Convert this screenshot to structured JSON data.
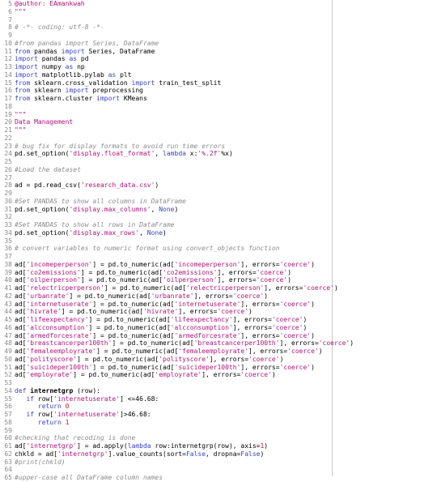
{
  "lines": [
    {
      "n": "5",
      "t": [
        {
          "c": "c-str",
          "s": "@author: EAmankwah"
        }
      ]
    },
    {
      "n": "6",
      "t": [
        {
          "c": "c-str",
          "s": "\"\"\""
        }
      ]
    },
    {
      "n": "7",
      "t": []
    },
    {
      "n": "8",
      "t": [
        {
          "c": "c-com",
          "s": "# -*- coding: utf-8 -*-"
        }
      ]
    },
    {
      "n": "9",
      "t": []
    },
    {
      "n": "10",
      "t": [
        {
          "c": "c-com",
          "s": "#from pandas import Series, DataFrame"
        }
      ]
    },
    {
      "n": "11",
      "t": [
        {
          "c": "c-kw",
          "s": "from"
        },
        {
          "c": "c-plain",
          "s": " pandas "
        },
        {
          "c": "c-kw",
          "s": "import"
        },
        {
          "c": "c-plain",
          "s": " Series, DataFrame"
        }
      ]
    },
    {
      "n": "12",
      "t": [
        {
          "c": "c-kw",
          "s": "import"
        },
        {
          "c": "c-plain",
          "s": " pandas "
        },
        {
          "c": "c-kw",
          "s": "as"
        },
        {
          "c": "c-plain",
          "s": " pd"
        }
      ]
    },
    {
      "n": "13",
      "t": [
        {
          "c": "c-kw",
          "s": "import"
        },
        {
          "c": "c-plain",
          "s": " numpy "
        },
        {
          "c": "c-kw",
          "s": "as"
        },
        {
          "c": "c-plain",
          "s": " np"
        }
      ]
    },
    {
      "n": "14",
      "t": [
        {
          "c": "c-kw",
          "s": "import"
        },
        {
          "c": "c-plain",
          "s": " matplotlib.pylab "
        },
        {
          "c": "c-kw",
          "s": "as"
        },
        {
          "c": "c-plain",
          "s": " plt"
        }
      ]
    },
    {
      "n": "15",
      "t": [
        {
          "c": "c-kw",
          "s": "from"
        },
        {
          "c": "c-plain",
          "s": " sklearn.cross_validation "
        },
        {
          "c": "c-kw",
          "s": "import"
        },
        {
          "c": "c-plain",
          "s": " train_test_split"
        }
      ]
    },
    {
      "n": "16",
      "t": [
        {
          "c": "c-kw",
          "s": "from"
        },
        {
          "c": "c-plain",
          "s": " sklearn "
        },
        {
          "c": "c-kw",
          "s": "import"
        },
        {
          "c": "c-plain",
          "s": " preprocessing"
        }
      ]
    },
    {
      "n": "17",
      "t": [
        {
          "c": "c-kw",
          "s": "from"
        },
        {
          "c": "c-plain",
          "s": " sklearn.cluster "
        },
        {
          "c": "c-kw",
          "s": "import"
        },
        {
          "c": "c-plain",
          "s": " KMeans"
        }
      ]
    },
    {
      "n": "18",
      "t": []
    },
    {
      "n": "19",
      "t": [
        {
          "c": "c-str",
          "s": "\"\"\""
        }
      ]
    },
    {
      "n": "20",
      "t": [
        {
          "c": "c-str",
          "s": "Data Management"
        }
      ]
    },
    {
      "n": "21",
      "t": [
        {
          "c": "c-str",
          "s": "\"\"\""
        }
      ]
    },
    {
      "n": "22",
      "t": []
    },
    {
      "n": "23",
      "t": [
        {
          "c": "c-com",
          "s": "# bug fix for display formats to avoid run time errors"
        }
      ]
    },
    {
      "n": "24",
      "t": [
        {
          "c": "c-plain",
          "s": "pd.set_option("
        },
        {
          "c": "c-str",
          "s": "'display.float_format'"
        },
        {
          "c": "c-plain",
          "s": ", "
        },
        {
          "c": "c-kw",
          "s": "lambda"
        },
        {
          "c": "c-plain",
          "s": " x:"
        },
        {
          "c": "c-str",
          "s": "'%.2f'"
        },
        {
          "c": "c-plain",
          "s": "%x)"
        }
      ]
    },
    {
      "n": "25",
      "t": []
    },
    {
      "n": "26",
      "t": [
        {
          "c": "c-com",
          "s": "#Load the dataset"
        }
      ]
    },
    {
      "n": "27",
      "t": []
    },
    {
      "n": "28",
      "t": [
        {
          "c": "c-plain",
          "s": "ad = pd.read_csv("
        },
        {
          "c": "c-str",
          "s": "'research_data.csv'"
        },
        {
          "c": "c-plain",
          "s": ")"
        }
      ]
    },
    {
      "n": "29",
      "t": []
    },
    {
      "n": "30",
      "t": [
        {
          "c": "c-com",
          "s": "#Set PANDAS to show all columns in DataFrame"
        }
      ]
    },
    {
      "n": "31",
      "t": [
        {
          "c": "c-plain",
          "s": "pd.set_option("
        },
        {
          "c": "c-str",
          "s": "'display.max_columns'"
        },
        {
          "c": "c-plain",
          "s": ", "
        },
        {
          "c": "c-kw",
          "s": "None"
        },
        {
          "c": "c-plain",
          "s": ")"
        }
      ]
    },
    {
      "n": "32",
      "t": []
    },
    {
      "n": "33",
      "t": [
        {
          "c": "c-com",
          "s": "#Set PANDAS to show all rows in DataFrame"
        }
      ]
    },
    {
      "n": "34",
      "t": [
        {
          "c": "c-plain",
          "s": "pd.set_option("
        },
        {
          "c": "c-str",
          "s": "'display.max_rows'"
        },
        {
          "c": "c-plain",
          "s": ", "
        },
        {
          "c": "c-kw",
          "s": "None"
        },
        {
          "c": "c-plain",
          "s": ")"
        }
      ]
    },
    {
      "n": "35",
      "t": []
    },
    {
      "n": "36",
      "t": [
        {
          "c": "c-com",
          "s": "# convert variables to numeric format using convert_objects function"
        }
      ]
    },
    {
      "n": "37",
      "t": []
    },
    {
      "n": "38",
      "t": [
        {
          "c": "c-plain",
          "s": "ad["
        },
        {
          "c": "c-str",
          "s": "'incomeperperson'"
        },
        {
          "c": "c-plain",
          "s": "] = pd.to_numeric(ad["
        },
        {
          "c": "c-str",
          "s": "'incomeperperson'"
        },
        {
          "c": "c-plain",
          "s": "], errors="
        },
        {
          "c": "c-str",
          "s": "'coerce'"
        },
        {
          "c": "c-plain",
          "s": ")"
        }
      ]
    },
    {
      "n": "39",
      "t": [
        {
          "c": "c-plain",
          "s": "ad["
        },
        {
          "c": "c-str",
          "s": "'co2emissions'"
        },
        {
          "c": "c-plain",
          "s": "] = pd.to_numeric(ad["
        },
        {
          "c": "c-str",
          "s": "'co2emissions'"
        },
        {
          "c": "c-plain",
          "s": "], errors="
        },
        {
          "c": "c-str",
          "s": "'coerce'"
        },
        {
          "c": "c-plain",
          "s": ")"
        }
      ]
    },
    {
      "n": "40",
      "t": [
        {
          "c": "c-plain",
          "s": "ad["
        },
        {
          "c": "c-str",
          "s": "'oilperperson'"
        },
        {
          "c": "c-plain",
          "s": "] = pd.to_numeric(ad["
        },
        {
          "c": "c-str",
          "s": "'oilperperson'"
        },
        {
          "c": "c-plain",
          "s": "], errors="
        },
        {
          "c": "c-str",
          "s": "'coerce'"
        },
        {
          "c": "c-plain",
          "s": ")"
        }
      ]
    },
    {
      "n": "41",
      "t": [
        {
          "c": "c-plain",
          "s": "ad["
        },
        {
          "c": "c-str",
          "s": "'relectricperperson'"
        },
        {
          "c": "c-plain",
          "s": "] = pd.to_numeric(ad["
        },
        {
          "c": "c-str",
          "s": "'relectricperperson'"
        },
        {
          "c": "c-plain",
          "s": "], errors="
        },
        {
          "c": "c-str",
          "s": "'coerce'"
        },
        {
          "c": "c-plain",
          "s": ")"
        }
      ]
    },
    {
      "n": "42",
      "t": [
        {
          "c": "c-plain",
          "s": "ad["
        },
        {
          "c": "c-str",
          "s": "'urbanrate'"
        },
        {
          "c": "c-plain",
          "s": "] = pd.to_numeric(ad["
        },
        {
          "c": "c-str",
          "s": "'urbanrate'"
        },
        {
          "c": "c-plain",
          "s": "], errors="
        },
        {
          "c": "c-str",
          "s": "'coerce'"
        },
        {
          "c": "c-plain",
          "s": ")"
        }
      ]
    },
    {
      "n": "43",
      "t": [
        {
          "c": "c-plain",
          "s": "ad["
        },
        {
          "c": "c-str",
          "s": "'internetuserate'"
        },
        {
          "c": "c-plain",
          "s": "] = pd.to_numeric(ad["
        },
        {
          "c": "c-str",
          "s": "'internetuserate'"
        },
        {
          "c": "c-plain",
          "s": "], errors="
        },
        {
          "c": "c-str",
          "s": "'coerce'"
        },
        {
          "c": "c-plain",
          "s": ")"
        }
      ]
    },
    {
      "n": "44",
      "t": [
        {
          "c": "c-plain",
          "s": "ad["
        },
        {
          "c": "c-str",
          "s": "'hivrate'"
        },
        {
          "c": "c-plain",
          "s": "] = pd.to_numeric(ad["
        },
        {
          "c": "c-str",
          "s": "'hivrate'"
        },
        {
          "c": "c-plain",
          "s": "], errors="
        },
        {
          "c": "c-str",
          "s": "'coerce'"
        },
        {
          "c": "c-plain",
          "s": ")"
        }
      ]
    },
    {
      "n": "45",
      "t": [
        {
          "c": "c-plain",
          "s": "ad["
        },
        {
          "c": "c-str",
          "s": "'lifeexpectancy'"
        },
        {
          "c": "c-plain",
          "s": "] = pd.to_numeric(ad["
        },
        {
          "c": "c-str",
          "s": "'lifeexpectancy'"
        },
        {
          "c": "c-plain",
          "s": "], errors="
        },
        {
          "c": "c-str",
          "s": "'coerce'"
        },
        {
          "c": "c-plain",
          "s": ")"
        }
      ]
    },
    {
      "n": "46",
      "t": [
        {
          "c": "c-plain",
          "s": "ad["
        },
        {
          "c": "c-str",
          "s": "'alcconsumption'"
        },
        {
          "c": "c-plain",
          "s": "] = pd.to_numeric(ad["
        },
        {
          "c": "c-str",
          "s": "'alcconsumption'"
        },
        {
          "c": "c-plain",
          "s": "], errors="
        },
        {
          "c": "c-str",
          "s": "'coerce'"
        },
        {
          "c": "c-plain",
          "s": ")"
        }
      ]
    },
    {
      "n": "47",
      "t": [
        {
          "c": "c-plain",
          "s": "ad["
        },
        {
          "c": "c-str",
          "s": "'armedforcesrate'"
        },
        {
          "c": "c-plain",
          "s": "] = pd.to_numeric(ad["
        },
        {
          "c": "c-str",
          "s": "'armedforcesrate'"
        },
        {
          "c": "c-plain",
          "s": "], errors="
        },
        {
          "c": "c-str",
          "s": "'coerce'"
        },
        {
          "c": "c-plain",
          "s": ")"
        }
      ]
    },
    {
      "n": "48",
      "t": [
        {
          "c": "c-plain",
          "s": "ad["
        },
        {
          "c": "c-str",
          "s": "'breastcancerper100th'"
        },
        {
          "c": "c-plain",
          "s": "] = pd.to_numeric(ad["
        },
        {
          "c": "c-str",
          "s": "'breastcancerper100th'"
        },
        {
          "c": "c-plain",
          "s": "], errors="
        },
        {
          "c": "c-str",
          "s": "'coerce'"
        },
        {
          "c": "c-plain",
          "s": ")"
        }
      ]
    },
    {
      "n": "49",
      "t": [
        {
          "c": "c-plain",
          "s": "ad["
        },
        {
          "c": "c-str",
          "s": "'femaleemployrate'"
        },
        {
          "c": "c-plain",
          "s": "] = pd.to_numeric(ad["
        },
        {
          "c": "c-str",
          "s": "'femaleemployrate'"
        },
        {
          "c": "c-plain",
          "s": "], errors="
        },
        {
          "c": "c-str",
          "s": "'coerce'"
        },
        {
          "c": "c-plain",
          "s": ")"
        }
      ]
    },
    {
      "n": "50",
      "t": [
        {
          "c": "c-plain",
          "s": "ad["
        },
        {
          "c": "c-str",
          "s": "'polityscore'"
        },
        {
          "c": "c-plain",
          "s": "] = pd.to_numeric(ad["
        },
        {
          "c": "c-str",
          "s": "'polityscore'"
        },
        {
          "c": "c-plain",
          "s": "], errors="
        },
        {
          "c": "c-str",
          "s": "'coerce'"
        },
        {
          "c": "c-plain",
          "s": ")"
        }
      ]
    },
    {
      "n": "51",
      "t": [
        {
          "c": "c-plain",
          "s": "ad["
        },
        {
          "c": "c-str",
          "s": "'suicideper100th'"
        },
        {
          "c": "c-plain",
          "s": "] = pd.to_numeric(ad["
        },
        {
          "c": "c-str",
          "s": "'suicideper100th'"
        },
        {
          "c": "c-plain",
          "s": "], errors="
        },
        {
          "c": "c-str",
          "s": "'coerce'"
        },
        {
          "c": "c-plain",
          "s": ")"
        }
      ]
    },
    {
      "n": "52",
      "t": [
        {
          "c": "c-plain",
          "s": "ad["
        },
        {
          "c": "c-str",
          "s": "'employrate'"
        },
        {
          "c": "c-plain",
          "s": "] = pd.to_numeric(ad["
        },
        {
          "c": "c-str",
          "s": "'employrate'"
        },
        {
          "c": "c-plain",
          "s": "], errors="
        },
        {
          "c": "c-str",
          "s": "'coerce'"
        },
        {
          "c": "c-plain",
          "s": ")"
        }
      ]
    },
    {
      "n": "53",
      "t": []
    },
    {
      "n": "54",
      "t": [
        {
          "c": "c-kw",
          "s": "def"
        },
        {
          "c": "c-plain",
          "s": " "
        },
        {
          "c": "c-fn",
          "s": "internetgrp"
        },
        {
          "c": "c-plain",
          "s": " (row):"
        }
      ]
    },
    {
      "n": "55",
      "t": [
        {
          "c": "c-plain",
          "s": "   "
        },
        {
          "c": "c-kw",
          "s": "if"
        },
        {
          "c": "c-plain",
          "s": " row["
        },
        {
          "c": "c-str",
          "s": "'internetuserate'"
        },
        {
          "c": "c-plain",
          "s": "] <=46.68:"
        }
      ]
    },
    {
      "n": "56",
      "t": [
        {
          "c": "c-plain",
          "s": "      "
        },
        {
          "c": "c-kw",
          "s": "return"
        },
        {
          "c": "c-plain",
          "s": " "
        },
        {
          "c": "c-num",
          "s": "0"
        }
      ]
    },
    {
      "n": "57",
      "t": [
        {
          "c": "c-plain",
          "s": "   "
        },
        {
          "c": "c-kw",
          "s": "if"
        },
        {
          "c": "c-plain",
          "s": " row["
        },
        {
          "c": "c-str",
          "s": "'internetuserate'"
        },
        {
          "c": "c-plain",
          "s": "]>46.68:"
        }
      ]
    },
    {
      "n": "58",
      "t": [
        {
          "c": "c-plain",
          "s": "      "
        },
        {
          "c": "c-kw",
          "s": "return"
        },
        {
          "c": "c-plain",
          "s": " "
        },
        {
          "c": "c-num",
          "s": "1"
        }
      ]
    },
    {
      "n": "59",
      "t": []
    },
    {
      "n": "60",
      "t": [
        {
          "c": "c-com",
          "s": "#checking that recoding is done"
        }
      ]
    },
    {
      "n": "61",
      "t": [
        {
          "c": "c-plain",
          "s": "ad["
        },
        {
          "c": "c-str",
          "s": "'internetgrp'"
        },
        {
          "c": "c-plain",
          "s": "] = ad.apply("
        },
        {
          "c": "c-kw",
          "s": "lambda"
        },
        {
          "c": "c-plain",
          "s": " row:internetgrp(row), axis="
        },
        {
          "c": "c-num",
          "s": "1"
        },
        {
          "c": "c-plain",
          "s": ")"
        }
      ]
    },
    {
      "n": "62",
      "t": [
        {
          "c": "c-plain",
          "s": "chkld = ad["
        },
        {
          "c": "c-str",
          "s": "'internetgrp'"
        },
        {
          "c": "c-plain",
          "s": "].value_counts(sort="
        },
        {
          "c": "c-kw",
          "s": "False"
        },
        {
          "c": "c-plain",
          "s": ", dropna="
        },
        {
          "c": "c-kw",
          "s": "False"
        },
        {
          "c": "c-plain",
          "s": ")"
        }
      ]
    },
    {
      "n": "63",
      "t": [
        {
          "c": "c-com",
          "s": "#print(chkld)"
        }
      ]
    },
    {
      "n": "64",
      "t": []
    },
    {
      "n": "65",
      "t": [
        {
          "c": "c-com",
          "s": "#upper-case all DataFrame column names"
        }
      ]
    }
  ]
}
